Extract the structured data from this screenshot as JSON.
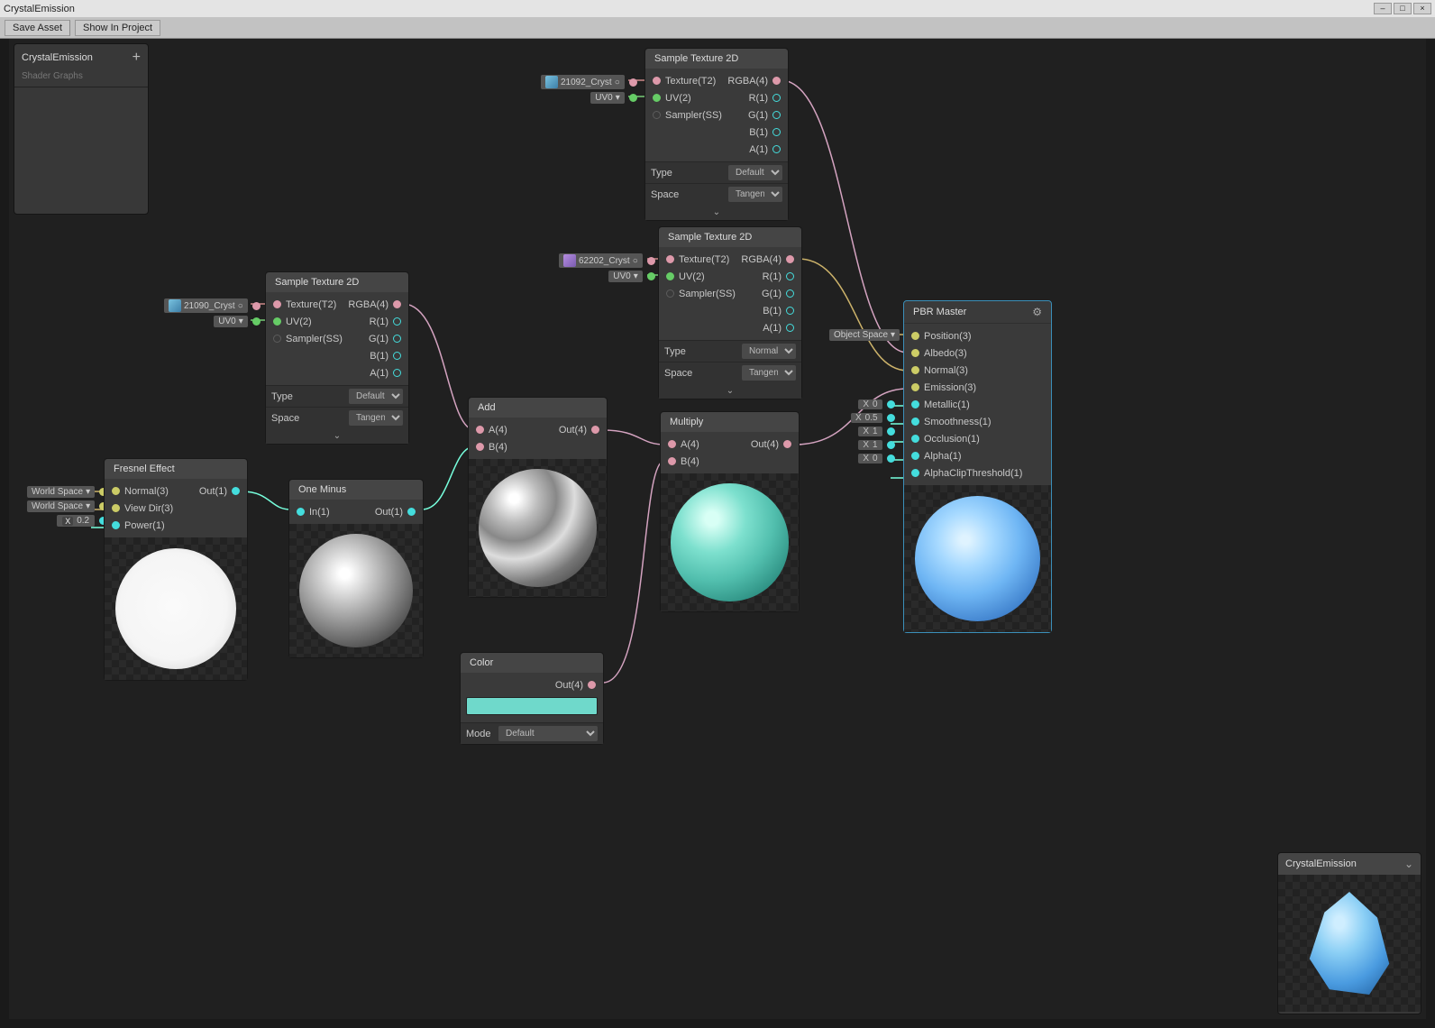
{
  "window": {
    "title": "CrystalEmission"
  },
  "toolbar": {
    "save": "Save Asset",
    "show": "Show In Project"
  },
  "blackboard": {
    "title": "CrystalEmission",
    "subtitle": "Shader Graphs"
  },
  "external_labels": {
    "tex_21092": "21092_Cryst",
    "tex_62202": "62202_Cryst",
    "tex_21090": "21090_Cryst",
    "uv0": "UV0",
    "world_space": "World Space",
    "object_space": "Object Space"
  },
  "nodes": {
    "sample_top": {
      "title": "Sample Texture 2D",
      "inputs": [
        "Texture(T2)",
        "UV(2)",
        "Sampler(SS)"
      ],
      "outputs": [
        "RGBA(4)",
        "R(1)",
        "G(1)",
        "B(1)",
        "A(1)"
      ],
      "type_label": "Type",
      "type_val": "Default",
      "space_label": "Space",
      "space_val": "Tangent"
    },
    "sample_mid": {
      "title": "Sample Texture 2D",
      "inputs": [
        "Texture(T2)",
        "UV(2)",
        "Sampler(SS)"
      ],
      "outputs": [
        "RGBA(4)",
        "R(1)",
        "G(1)",
        "B(1)",
        "A(1)"
      ],
      "type_label": "Type",
      "type_val": "Normal",
      "space_label": "Space",
      "space_val": "Tangent"
    },
    "sample_left": {
      "title": "Sample Texture 2D",
      "inputs": [
        "Texture(T2)",
        "UV(2)",
        "Sampler(SS)"
      ],
      "outputs": [
        "RGBA(4)",
        "R(1)",
        "G(1)",
        "B(1)",
        "A(1)"
      ],
      "type_label": "Type",
      "type_val": "Default",
      "space_label": "Space",
      "space_val": "Tangent"
    },
    "fresnel": {
      "title": "Fresnel Effect",
      "inputs": [
        "Normal(3)",
        "View Dir(3)",
        "Power(1)"
      ],
      "power_val": "0.2",
      "output": "Out(1)"
    },
    "one_minus": {
      "title": "One Minus",
      "input": "In(1)",
      "output": "Out(1)"
    },
    "add": {
      "title": "Add",
      "inputs": [
        "A(4)",
        "B(4)"
      ],
      "output": "Out(4)"
    },
    "multiply": {
      "title": "Multiply",
      "inputs": [
        "A(4)",
        "B(4)"
      ],
      "output": "Out(4)"
    },
    "color": {
      "title": "Color",
      "output": "Out(4)",
      "mode_label": "Mode",
      "mode_val": "Default"
    },
    "pbr": {
      "title": "PBR Master",
      "ports": [
        "Position(3)",
        "Albedo(3)",
        "Normal(3)",
        "Emission(3)",
        "Metallic(1)",
        "Smoothness(1)",
        "Occlusion(1)",
        "Alpha(1)",
        "AlphaClipThreshold(1)"
      ],
      "vals": {
        "metallic": "0",
        "smoothness": "0.5",
        "occlusion": "1",
        "alpha": "1",
        "clip": "0"
      }
    }
  },
  "inspector": {
    "title": "CrystalEmission"
  },
  "x_label": "X"
}
